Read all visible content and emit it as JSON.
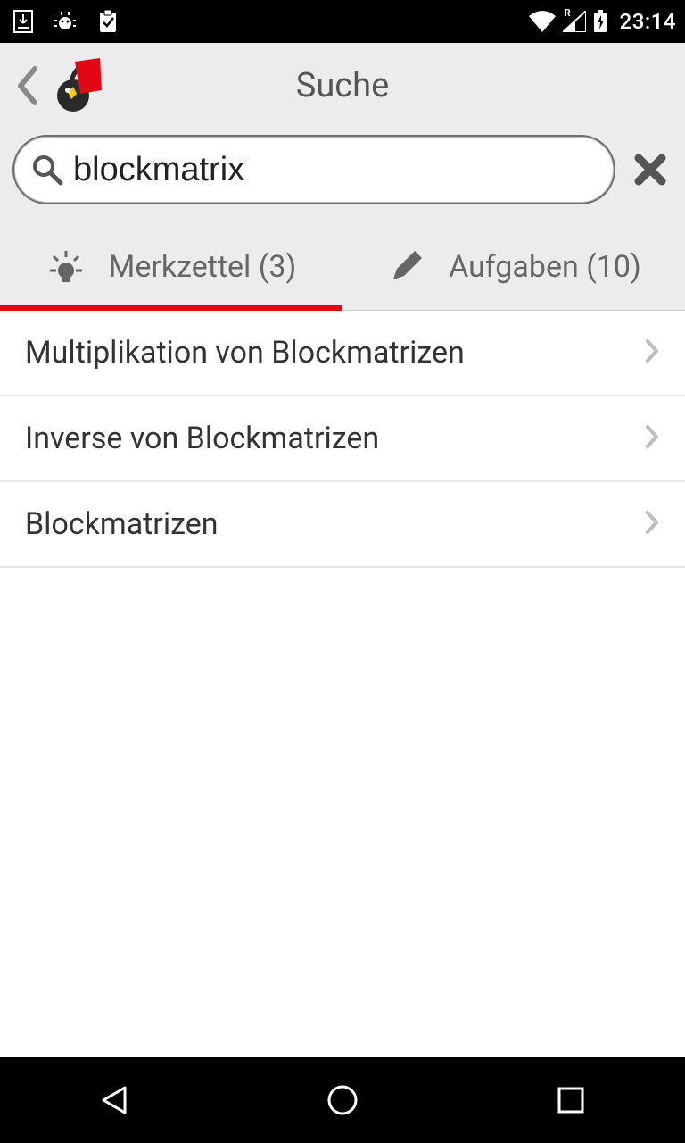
{
  "status": {
    "time": "23:14",
    "roaming_badge": "R"
  },
  "header": {
    "title": "Suche"
  },
  "search": {
    "value": "blockmatrix",
    "placeholder": ""
  },
  "tabs": [
    {
      "icon": "idea-icon",
      "label": "Merkzettel (3)",
      "active": true
    },
    {
      "icon": "pencil-icon",
      "label": "Aufgaben (10)",
      "active": false
    }
  ],
  "results": [
    {
      "label": "Multiplikation von Blockmatrizen"
    },
    {
      "label": "Inverse von Blockmatrizen"
    },
    {
      "label": "Blockmatrizen"
    }
  ]
}
